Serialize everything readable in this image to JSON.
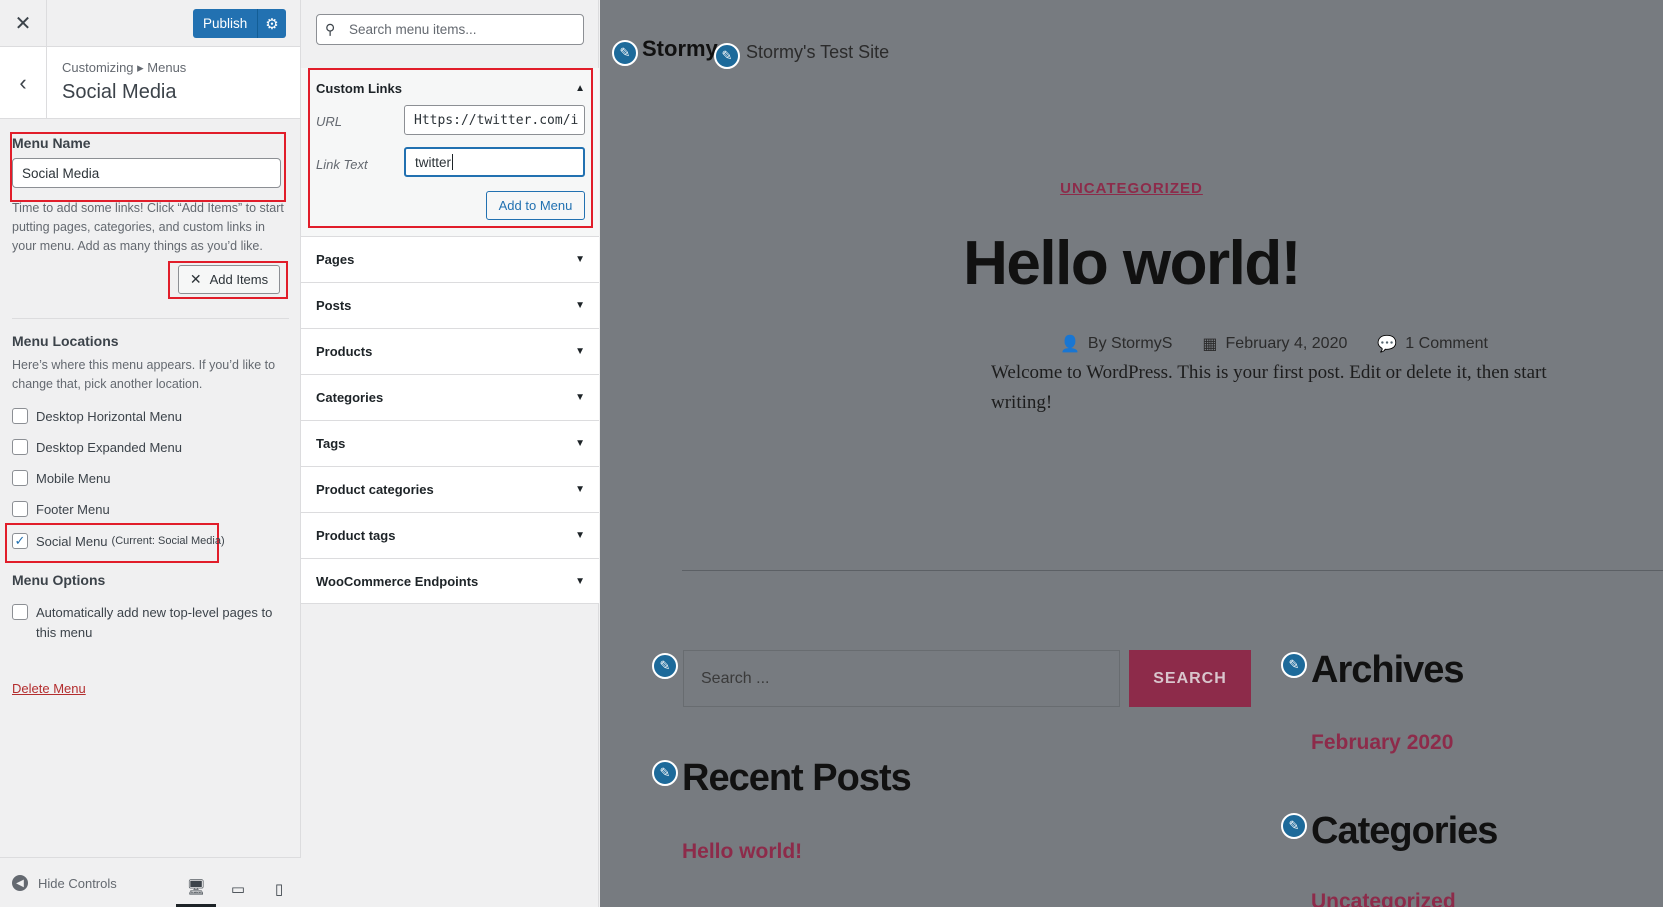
{
  "header": {
    "close_icon": "close-icon",
    "publish_label": "Publish",
    "publish_settings_icon": "gear-icon"
  },
  "section": {
    "breadcrumb": "Customizing ▸ Menus",
    "title": "Social Media"
  },
  "menu_name": {
    "label": "Menu Name",
    "value": "Social Media"
  },
  "help_text": "Time to add some links! Click “Add Items” to start putting pages, categories, and custom links in your menu. Add as many things as you’d like.",
  "add_items_label": "Add Items",
  "locations": {
    "title": "Menu Locations",
    "help": "Here’s where this menu appears. If you’d like to change that, pick another location.",
    "items": [
      {
        "label": "Desktop Horizontal Menu",
        "checked": false
      },
      {
        "label": "Desktop Expanded Menu",
        "checked": false
      },
      {
        "label": "Mobile Menu",
        "checked": false
      },
      {
        "label": "Footer Menu",
        "checked": false
      },
      {
        "label": "Social Menu",
        "note": "(Current: Social Media)",
        "checked": true
      }
    ]
  },
  "options": {
    "title": "Menu Options",
    "auto_add_label": "Automatically add new top-level pages to this menu"
  },
  "delete_label": "Delete Menu",
  "footer": {
    "hide_controls": "Hide Controls"
  },
  "panel": {
    "search_placeholder": "Search menu items...",
    "custom_links": {
      "title": "Custom Links",
      "url_label": "URL",
      "url_value": "Https://twitter.com/i",
      "link_text_label": "Link Text",
      "link_text_value": "twitter",
      "add_button": "Add to Menu"
    },
    "sections": [
      "Pages",
      "Posts",
      "Products",
      "Categories",
      "Tags",
      "Product categories",
      "Product tags",
      "WooCommerce Endpoints"
    ]
  },
  "preview": {
    "site_logo_text": "Stormy",
    "site_title": "Stormy's Test Site",
    "category": "UNCATEGORIZED",
    "post_title": "Hello world!",
    "author": "By StormyS",
    "date": "February 4, 2020",
    "comments": "1 Comment",
    "excerpt": "Welcome to WordPress. This is your first post. Edit or delete it, then start writing!",
    "search_placeholder": "Search ...",
    "search_button": "SEARCH",
    "archives_title": "Archives",
    "archives_item": "February 2020",
    "recent_posts_title": "Recent Posts",
    "recent_post_item": "Hello world!",
    "categories_title": "Categories",
    "categories_item": "Uncategorized"
  },
  "colors": {
    "accent": "#2271b1",
    "highlight_box": "#e11d2a",
    "preview_link": "#8d2b4a"
  }
}
